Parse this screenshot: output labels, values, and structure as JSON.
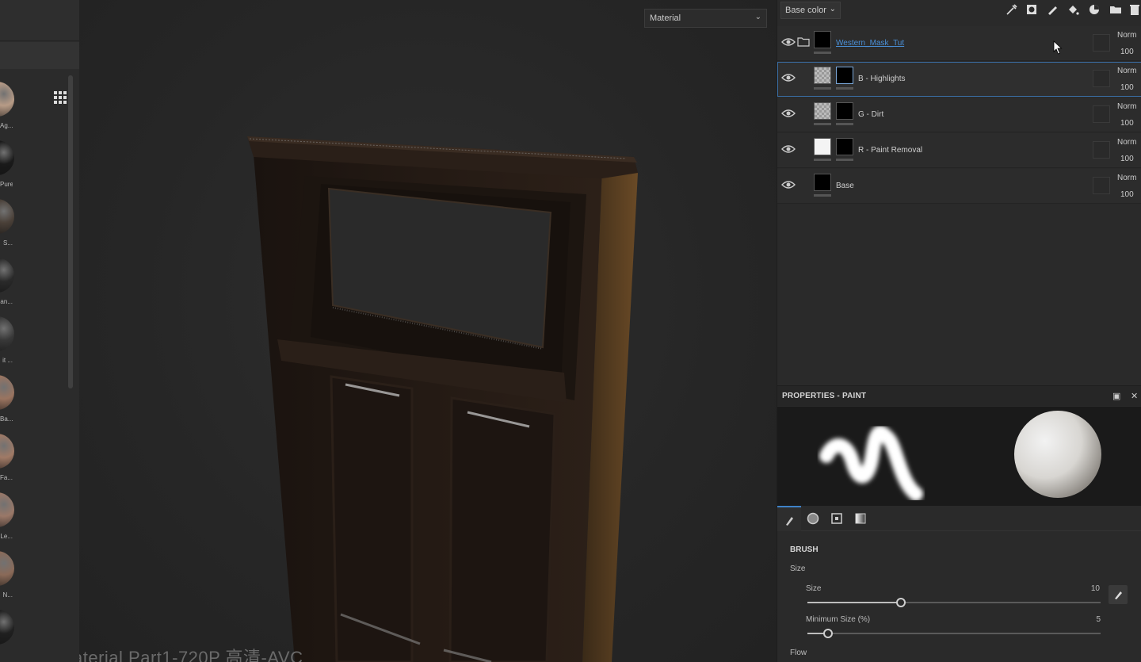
{
  "viewport": {
    "display_select": "Material"
  },
  "shelf": {
    "materials": [
      {
        "label": "Ag...",
        "color": "#b79b86"
      },
      {
        "label": "Pure",
        "color": "#1a1a1a"
      },
      {
        "label": "S...",
        "color": "#4a4038"
      },
      {
        "label": "an...",
        "color": "#2a2a2a"
      },
      {
        "label": "it ...",
        "color": "#383838"
      },
      {
        "label": "Ba...",
        "color": "#9a7460"
      },
      {
        "label": "Fa...",
        "color": "#a07a66"
      },
      {
        "label": "Le...",
        "color": "#9a7868"
      },
      {
        "label": "N...",
        "color": "#8a6a58"
      },
      {
        "label": "",
        "color": "#202020"
      }
    ]
  },
  "toolbar": {
    "channel_select": "Base color",
    "icons": [
      "add-effect-icon",
      "add-mask-icon",
      "add-paint-layer-icon",
      "add-fill-layer-icon",
      "add-smart-material-icon",
      "add-folder-icon",
      "delete-layer-icon"
    ]
  },
  "layers": [
    {
      "name": "Western_Mask_Tut",
      "blend_mode": "Norm",
      "opacity": "100",
      "is_folder": true
    },
    {
      "name": "B - Highlights",
      "blend_mode": "Norm",
      "opacity": "100",
      "selected": true
    },
    {
      "name": "G - Dirt",
      "blend_mode": "Norm",
      "opacity": "100"
    },
    {
      "name": "R - Paint Removal",
      "blend_mode": "Norm",
      "opacity": "100"
    },
    {
      "name": "Base",
      "blend_mode": "Norm",
      "opacity": "100"
    }
  ],
  "properties": {
    "title": "PROPERTIES - PAINT",
    "brush": {
      "section_title": "BRUSH",
      "group_label": "Size",
      "size": {
        "label": "Size",
        "value": "10",
        "fraction": 0.32
      },
      "min_size": {
        "label": "Minimum Size (%)",
        "value": "5",
        "fraction": 0.07
      },
      "flow_label": "Flow"
    }
  },
  "watermark": "aterial Part1-720P 高清-AVC"
}
